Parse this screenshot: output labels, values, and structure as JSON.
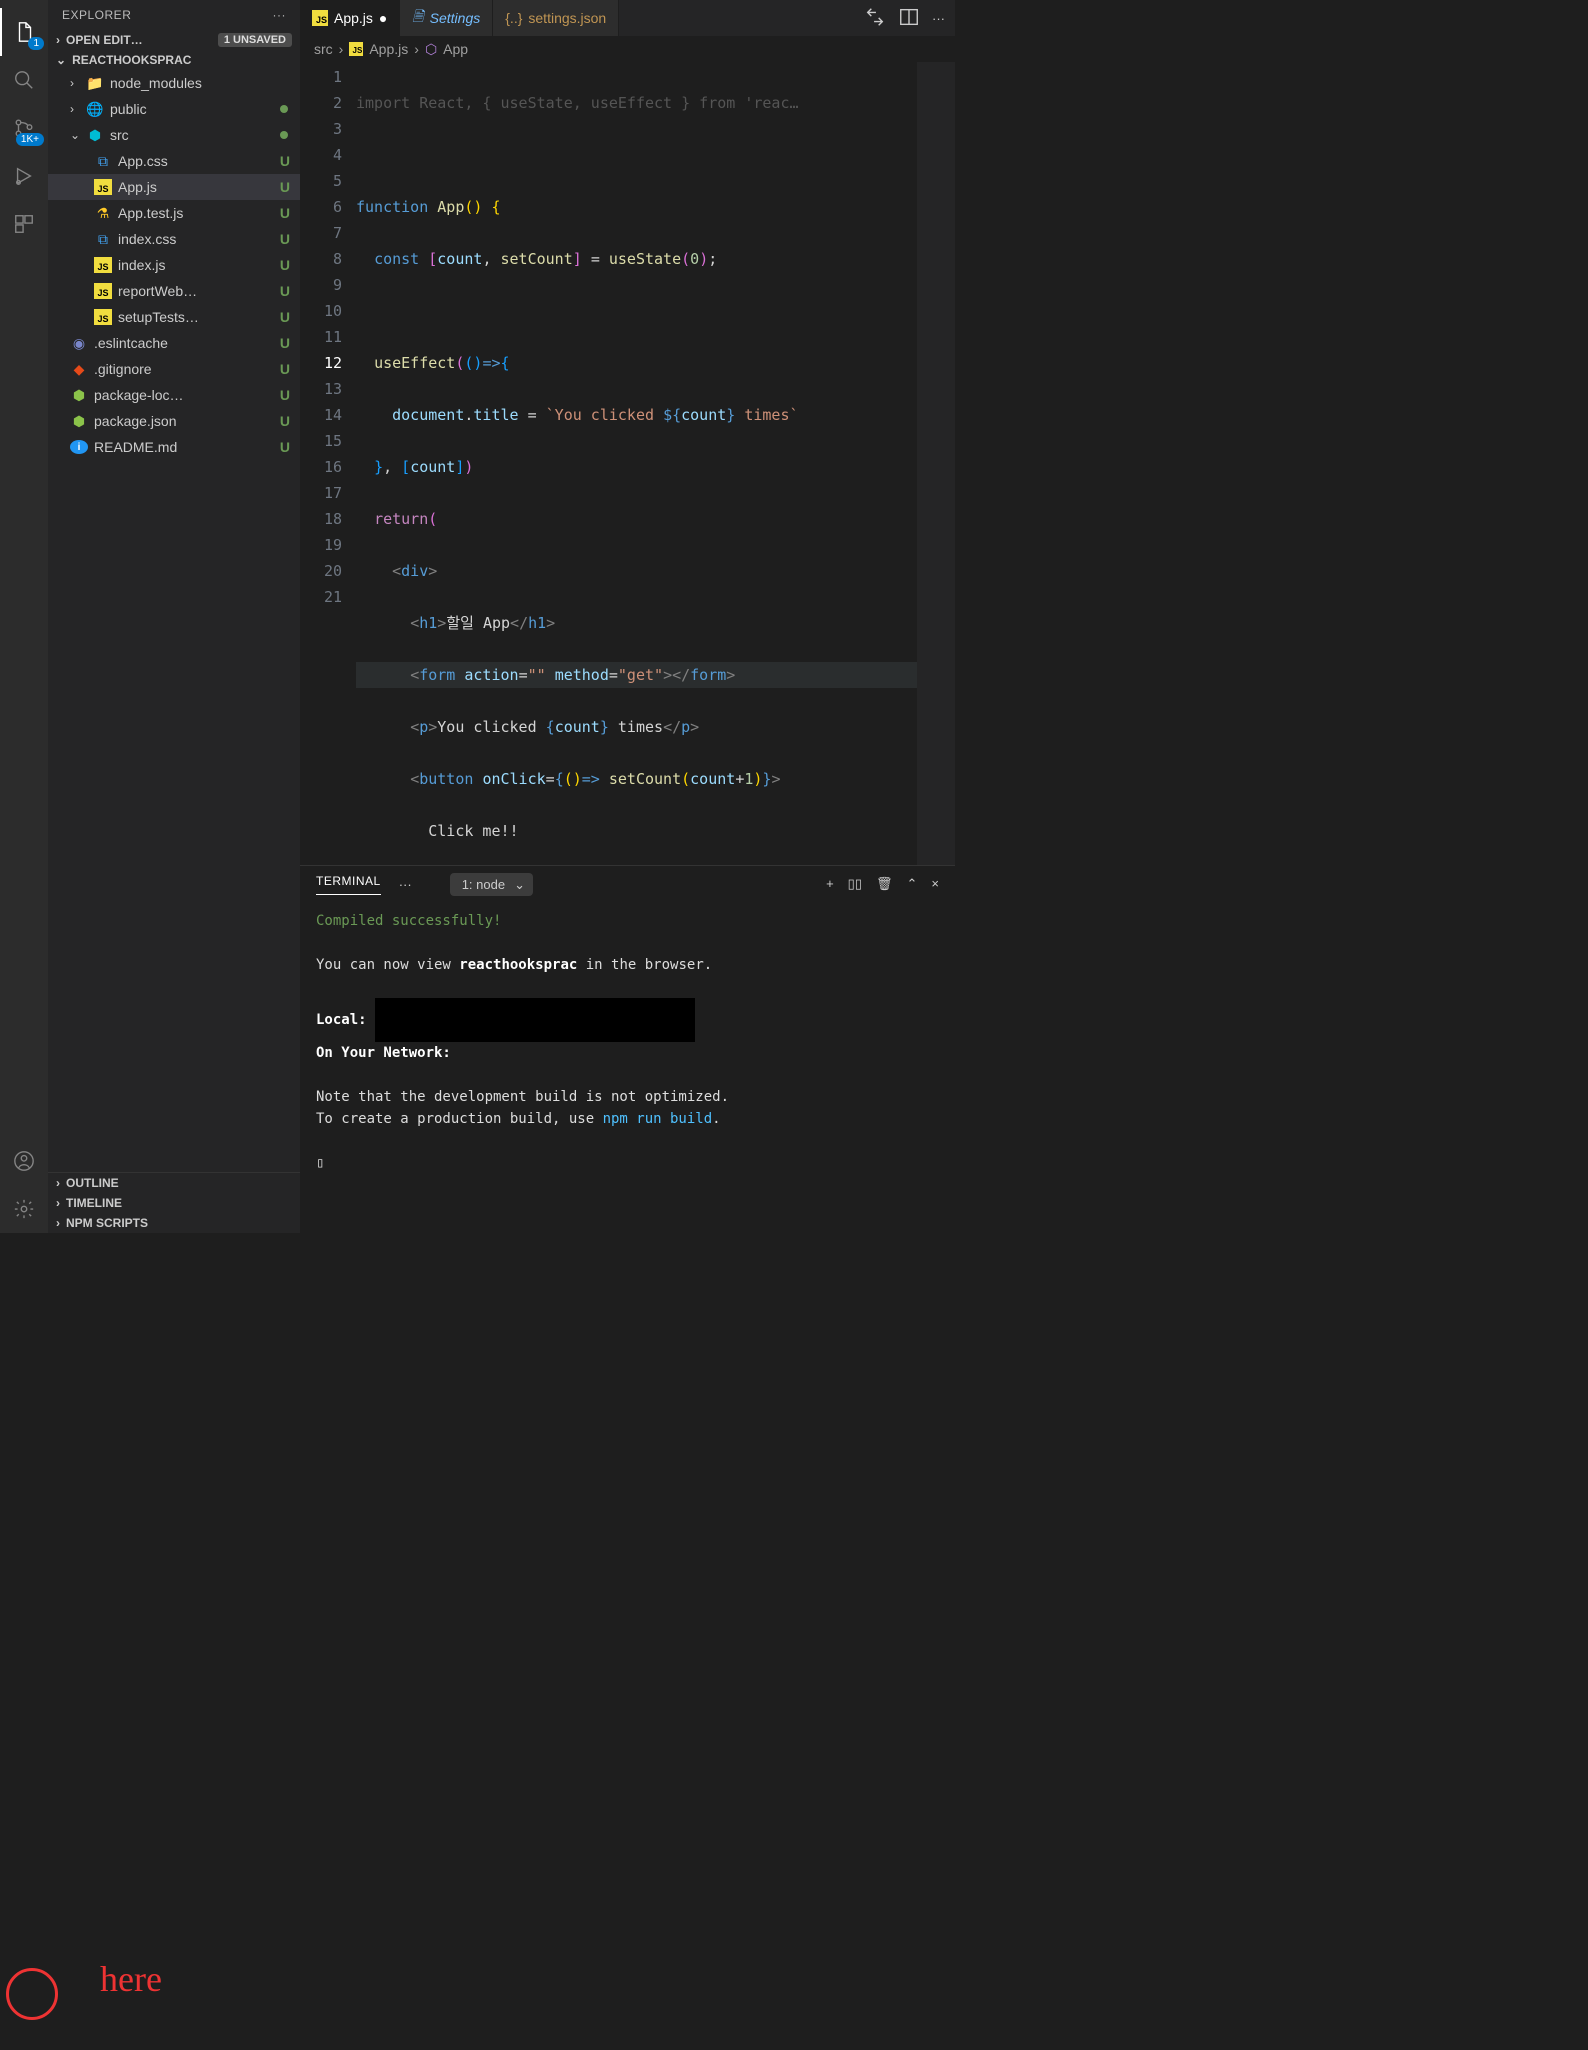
{
  "activity": {
    "explorer_badge": "1",
    "scm_badge": "1K+"
  },
  "sidebar": {
    "title": "EXPLORER",
    "openEditors": {
      "label": "OPEN EDIT…",
      "badge": "1 UNSAVED"
    },
    "project": "REACTHOOKSPRAC",
    "tree": {
      "node_modules": "node_modules",
      "public": "public",
      "src": "src",
      "files": [
        {
          "name": "App.css",
          "status": "U"
        },
        {
          "name": "App.js",
          "status": "U",
          "active": true
        },
        {
          "name": "App.test.js",
          "status": "U"
        },
        {
          "name": "index.css",
          "status": "U"
        },
        {
          "name": "index.js",
          "status": "U"
        },
        {
          "name": "reportWeb…",
          "status": "U"
        },
        {
          "name": "setupTests…",
          "status": "U"
        }
      ],
      "root_files": [
        {
          "name": ".eslintcache",
          "status": "U"
        },
        {
          "name": ".gitignore",
          "status": "U"
        },
        {
          "name": "package-loc…",
          "status": "U"
        },
        {
          "name": "package.json",
          "status": "U"
        },
        {
          "name": "README.md",
          "status": "U"
        }
      ]
    },
    "bottom": [
      "OUTLINE",
      "TIMELINE",
      "NPM SCRIPTS"
    ]
  },
  "tabs": [
    {
      "label": "App.js",
      "dirty": true,
      "active": true,
      "icon": "js"
    },
    {
      "label": "Settings",
      "italic": true,
      "icon": "file"
    },
    {
      "label": "settings.json",
      "icon": "json"
    }
  ],
  "breadcrumb": [
    "src",
    "App.js",
    "App"
  ],
  "editor": {
    "last_line": 21,
    "cursor_line": 12
  },
  "panel": {
    "tab": "TERMINAL",
    "select": "1: node",
    "lines": {
      "compiled": "Compiled successfully!",
      "view1": "You can now view ",
      "proj": "reacthooksprac",
      "view2": " in the browser.",
      "local": "  Local:",
      "network": "  On Your Network:",
      "note1": "Note that the development build is not optimized.",
      "note2a": "To create a production build, use ",
      "note2cmd": "npm run build",
      "note2b": "."
    }
  },
  "annotation": "here"
}
